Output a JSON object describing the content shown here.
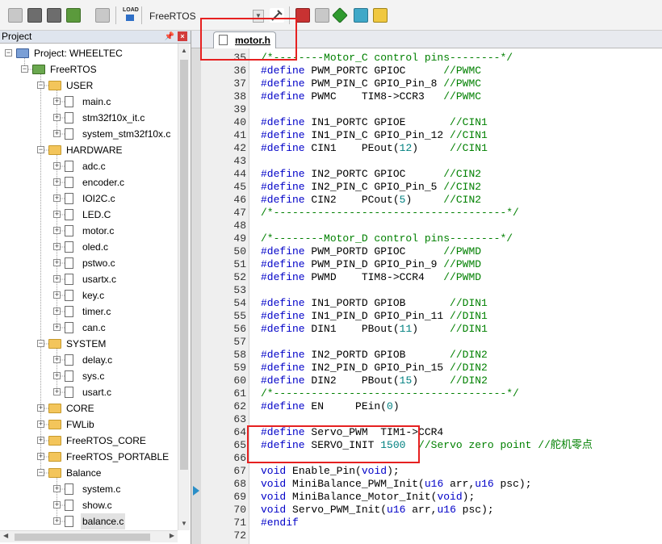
{
  "toolbar": {
    "target": "FreeRTOS",
    "load_label": "LOAD"
  },
  "project_panel": {
    "title": "Project",
    "tree": [
      {
        "label": "Project: WHEELTEC",
        "kind": "project",
        "level": 0
      },
      {
        "label": "FreeRTOS",
        "kind": "target",
        "level": 1
      },
      {
        "label": "USER",
        "kind": "folder",
        "level": 2
      },
      {
        "label": "main.c",
        "kind": "file",
        "level": 3
      },
      {
        "label": "stm32f10x_it.c",
        "kind": "file",
        "level": 3
      },
      {
        "label": "system_stm32f10x.c",
        "kind": "file",
        "level": 3
      },
      {
        "label": "HARDWARE",
        "kind": "folder",
        "level": 2
      },
      {
        "label": "adc.c",
        "kind": "file",
        "level": 3
      },
      {
        "label": "encoder.c",
        "kind": "file",
        "level": 3
      },
      {
        "label": "IOI2C.c",
        "kind": "file",
        "level": 3
      },
      {
        "label": "LED.C",
        "kind": "file",
        "level": 3
      },
      {
        "label": "motor.c",
        "kind": "file",
        "level": 3
      },
      {
        "label": "oled.c",
        "kind": "file",
        "level": 3
      },
      {
        "label": "pstwo.c",
        "kind": "file",
        "level": 3
      },
      {
        "label": "usartx.c",
        "kind": "file",
        "level": 3
      },
      {
        "label": "key.c",
        "kind": "file",
        "level": 3
      },
      {
        "label": "timer.c",
        "kind": "file",
        "level": 3
      },
      {
        "label": "can.c",
        "kind": "file",
        "level": 3
      },
      {
        "label": "SYSTEM",
        "kind": "folder",
        "level": 2
      },
      {
        "label": "delay.c",
        "kind": "file",
        "level": 3
      },
      {
        "label": "sys.c",
        "kind": "file",
        "level": 3
      },
      {
        "label": "usart.c",
        "kind": "file",
        "level": 3
      },
      {
        "label": "CORE",
        "kind": "folder-collapsed",
        "level": 2
      },
      {
        "label": "FWLib",
        "kind": "folder-collapsed",
        "level": 2
      },
      {
        "label": "FreeRTOS_CORE",
        "kind": "folder-collapsed",
        "level": 2
      },
      {
        "label": "FreeRTOS_PORTABLE",
        "kind": "folder-collapsed",
        "level": 2
      },
      {
        "label": "Balance",
        "kind": "folder",
        "level": 2
      },
      {
        "label": "system.c",
        "kind": "file",
        "level": 3
      },
      {
        "label": "show.c",
        "kind": "file",
        "level": 3
      },
      {
        "label": "balance.c",
        "kind": "file",
        "level": 3,
        "selected": true
      }
    ]
  },
  "editor": {
    "tab": "motor.h",
    "lines": [
      {
        "n": "35",
        "t": "/*--------Motor_C control pins--------*/"
      },
      {
        "n": "36",
        "t": "#define PWM_PORTC GPIOC      //PWMC"
      },
      {
        "n": "37",
        "t": "#define PWM_PIN_C GPIO_Pin_8 //PWMC"
      },
      {
        "n": "38",
        "t": "#define PWMC    TIM8->CCR3   //PWMC"
      },
      {
        "n": "39",
        "t": ""
      },
      {
        "n": "40",
        "t": "#define IN1_PORTC GPIOE       //CIN1"
      },
      {
        "n": "41",
        "t": "#define IN1_PIN_C GPIO_Pin_12 //CIN1"
      },
      {
        "n": "42",
        "t": "#define CIN1    PEout(12)     //CIN1"
      },
      {
        "n": "43",
        "t": ""
      },
      {
        "n": "44",
        "t": "#define IN2_PORTC GPIOC      //CIN2"
      },
      {
        "n": "45",
        "t": "#define IN2_PIN_C GPIO_Pin_5 //CIN2"
      },
      {
        "n": "46",
        "t": "#define CIN2    PCout(5)     //CIN2"
      },
      {
        "n": "47",
        "t": "/*-------------------------------------*/"
      },
      {
        "n": "48",
        "t": ""
      },
      {
        "n": "49",
        "t": "/*--------Motor_D control pins--------*/"
      },
      {
        "n": "50",
        "t": "#define PWM_PORTD GPIOC      //PWMD"
      },
      {
        "n": "51",
        "t": "#define PWM_PIN_D GPIO_Pin_9 //PWMD"
      },
      {
        "n": "52",
        "t": "#define PWMD    TIM8->CCR4   //PWMD"
      },
      {
        "n": "53",
        "t": ""
      },
      {
        "n": "54",
        "t": "#define IN1_PORTD GPIOB       //DIN1"
      },
      {
        "n": "55",
        "t": "#define IN1_PIN_D GPIO_Pin_11 //DIN1"
      },
      {
        "n": "56",
        "t": "#define DIN1    PBout(11)     //DIN1"
      },
      {
        "n": "57",
        "t": ""
      },
      {
        "n": "58",
        "t": "#define IN2_PORTD GPIOB       //DIN2"
      },
      {
        "n": "59",
        "t": "#define IN2_PIN_D GPIO_Pin_15 //DIN2"
      },
      {
        "n": "60",
        "t": "#define DIN2    PBout(15)     //DIN2"
      },
      {
        "n": "61",
        "t": "/*-------------------------------------*/"
      },
      {
        "n": "62",
        "t": "#define EN     PEin(0)"
      },
      {
        "n": "63",
        "t": ""
      },
      {
        "n": "64",
        "t": "#define Servo_PWM  TIM1->CCR4"
      },
      {
        "n": "65",
        "t": "#define SERVO_INIT 1500  //Servo zero point //舵机零点"
      },
      {
        "n": "66",
        "t": ""
      },
      {
        "n": "67",
        "t": "void Enable_Pin(void);"
      },
      {
        "n": "68",
        "t": "void MiniBalance_PWM_Init(u16 arr,u16 psc);"
      },
      {
        "n": "69",
        "t": "void MiniBalance_Motor_Init(void);"
      },
      {
        "n": "70",
        "t": "void Servo_PWM_Init(u16 arr,u16 psc);"
      },
      {
        "n": "71",
        "t": "#endif"
      },
      {
        "n": "72",
        "t": ""
      }
    ]
  },
  "colors": {
    "keyword": "#0000c8",
    "comment": "#008000",
    "number": "#008080",
    "highlight": "#e62020"
  }
}
